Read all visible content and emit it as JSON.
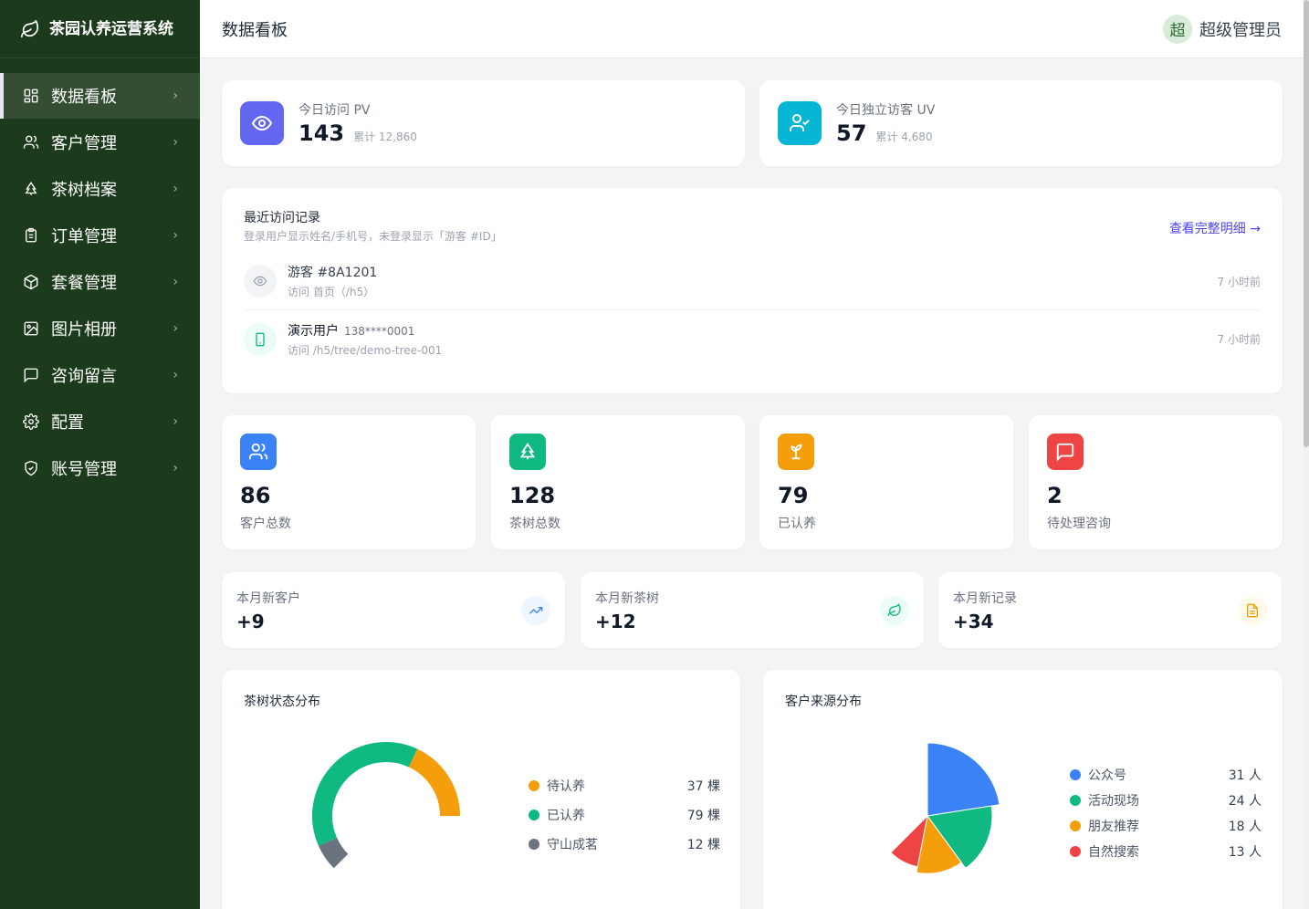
{
  "app": {
    "title": "茶园认养运营系统"
  },
  "sidebar": {
    "items": [
      {
        "label": "数据看板",
        "icon": "dashboard-icon"
      },
      {
        "label": "客户管理",
        "icon": "users-icon"
      },
      {
        "label": "茶树档案",
        "icon": "tree-icon"
      },
      {
        "label": "订单管理",
        "icon": "clipboard-icon"
      },
      {
        "label": "套餐管理",
        "icon": "package-icon"
      },
      {
        "label": "图片相册",
        "icon": "image-icon"
      },
      {
        "label": "咨询留言",
        "icon": "message-icon"
      },
      {
        "label": "配置",
        "icon": "gear-icon"
      },
      {
        "label": "账号管理",
        "icon": "shield-icon"
      }
    ],
    "chevron": "›"
  },
  "header": {
    "title": "数据看板",
    "admin_initial": "超",
    "admin_name": "超级管理员"
  },
  "traffic": {
    "pv": {
      "label": "今日访问 PV",
      "value": "143",
      "total": "累计 12,860",
      "color": "#6366f1"
    },
    "uv": {
      "label": "今日独立访客 UV",
      "value": "57",
      "total": "累计 4,680",
      "color": "#06b6d4"
    }
  },
  "recent": {
    "title": "最近访问记录",
    "subtitle": "登录用户显示姓名/手机号，未登录显示「游客 #ID」",
    "link": "查看完整明细 →",
    "visits": [
      {
        "name": "游客 #8A1201",
        "phone": "",
        "path": "访问 首页（/h5）",
        "time": "7 小时前"
      },
      {
        "name": "演示用户",
        "phone": "138****0001",
        "path": "访问 /h5/tree/demo-tree-001",
        "time": "7 小时前"
      }
    ]
  },
  "kpis": [
    {
      "value": "86",
      "label": "客户总数",
      "color": "#3b82f6"
    },
    {
      "value": "128",
      "label": "茶树总数",
      "color": "#10b981"
    },
    {
      "value": "79",
      "label": "已认养",
      "color": "#f59e0b"
    },
    {
      "value": "2",
      "label": "待处理咨询",
      "color": "#ef4444"
    }
  ],
  "monthly": [
    {
      "label": "本月新客户",
      "value": "+9"
    },
    {
      "label": "本月新茶树",
      "value": "+12"
    },
    {
      "label": "本月新记录",
      "value": "+34"
    }
  ],
  "tree_chart": {
    "title": "茶树状态分布",
    "rows": [
      {
        "name": "待认养",
        "value": "37 棵"
      },
      {
        "name": "已认养",
        "value": "79 棵"
      },
      {
        "name": "守山成茗",
        "value": "12 棵"
      }
    ]
  },
  "source_chart": {
    "title": "客户来源分布",
    "rows": [
      {
        "name": "公众号",
        "value": "31 人"
      },
      {
        "name": "活动现场",
        "value": "24 人"
      },
      {
        "name": "朋友推荐",
        "value": "18 人"
      },
      {
        "name": "自然搜索",
        "value": "13 人"
      }
    ]
  },
  "chart_data": [
    {
      "type": "pie",
      "title": "茶树状态分布",
      "categories": [
        "待认养",
        "已认养",
        "守山成茗"
      ],
      "values": [
        37,
        79,
        12
      ],
      "colors": [
        "#f59e0b",
        "#10b981",
        "#6b7280"
      ],
      "style": "half-donut"
    },
    {
      "type": "pie",
      "title": "客户来源分布",
      "categories": [
        "公众号",
        "活动现场",
        "朋友推荐",
        "自然搜索"
      ],
      "values": [
        31,
        24,
        18,
        13
      ],
      "colors": [
        "#3b82f6",
        "#10b981",
        "#f59e0b",
        "#ef4444"
      ],
      "style": "half-rose"
    }
  ]
}
